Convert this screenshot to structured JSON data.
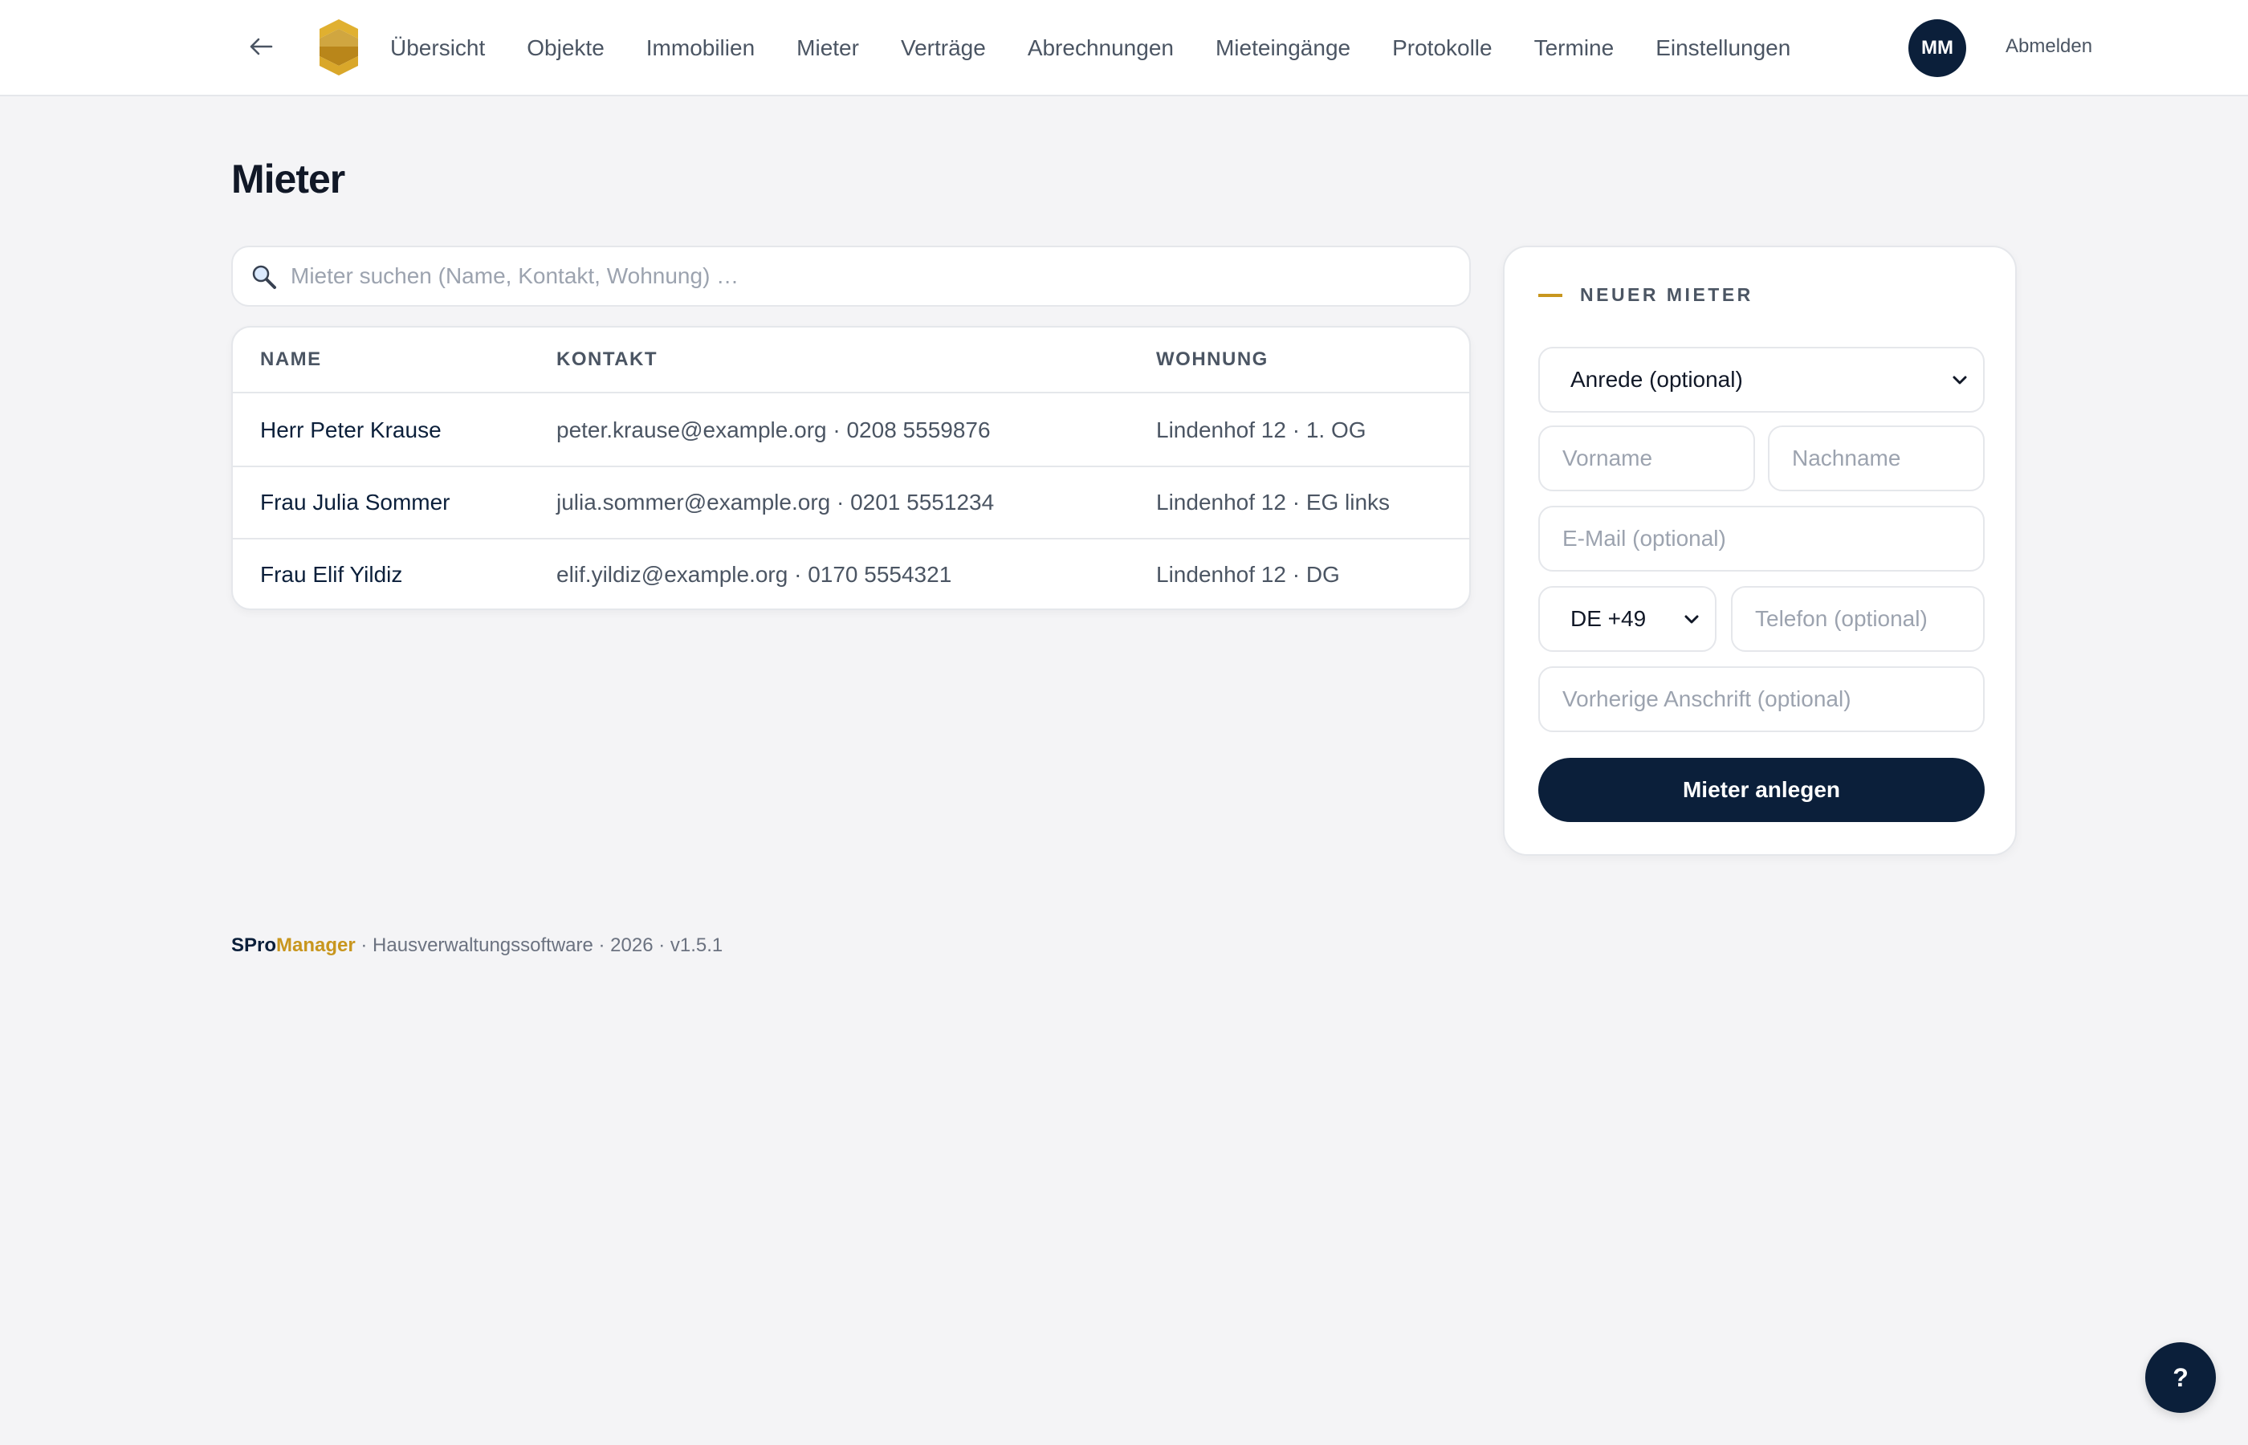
{
  "nav": {
    "back_icon": "arrow-left-icon",
    "logo_icon": "spro-logo-icon",
    "items": [
      {
        "label": "Übersicht"
      },
      {
        "label": "Objekte"
      },
      {
        "label": "Immobilien"
      },
      {
        "label": "Mieter"
      },
      {
        "label": "Verträge"
      },
      {
        "label": "Abrechnungen"
      },
      {
        "label": "Mieteingänge"
      },
      {
        "label": "Protokolle"
      },
      {
        "label": "Termine"
      },
      {
        "label": "Einstellungen"
      }
    ],
    "avatar_initials": "MM",
    "logout_label": "Abmelden"
  },
  "page": {
    "title": "Mieter"
  },
  "search": {
    "icon": "search-icon",
    "placeholder": "Mieter suchen (Name, Kontakt, Wohnung) …",
    "value": ""
  },
  "table": {
    "columns": [
      "NAME",
      "KONTAKT",
      "WOHNUNG"
    ],
    "rows": [
      {
        "name": "Herr Peter Krause",
        "contact": "peter.krause@example.org · 0208 5559876",
        "unit": "Lindenhof 12 · 1. OG"
      },
      {
        "name": "Frau Julia Sommer",
        "contact": "julia.sommer@example.org · 0201 5551234",
        "unit": "Lindenhof 12 · EG links"
      },
      {
        "name": "Frau Elif Yildiz",
        "contact": "elif.yildiz@example.org · 0170 5554321",
        "unit": "Lindenhof 12 · DG"
      }
    ]
  },
  "form": {
    "title": "NEUER MIETER",
    "salutation_selected": "Anrede (optional)",
    "firstname_placeholder": "Vorname",
    "lastname_placeholder": "Nachname",
    "email_placeholder": "E-Mail (optional)",
    "country_code_selected": "DE +49",
    "phone_placeholder": "Telefon (optional)",
    "prev_address_placeholder": "Vorherige Anschrift (optional)",
    "submit_label": "Mieter anlegen"
  },
  "footer": {
    "brand_part1": "SPro",
    "brand_part2": "Manager",
    "rest": " · Hausverwaltungssoftware · 2026 · v1.5.1"
  },
  "help": {
    "label": "?"
  },
  "colors": {
    "brand_navy": "#0b1f3a",
    "brand_gold": "#c8961e",
    "background": "#f4f4f6"
  }
}
